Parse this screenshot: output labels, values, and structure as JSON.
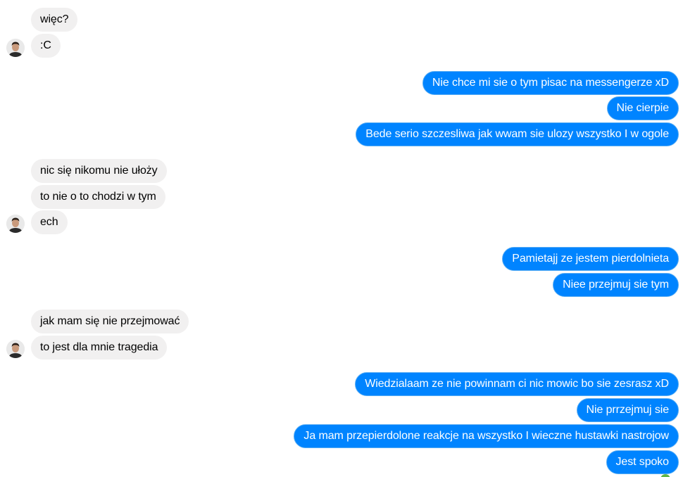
{
  "groups": [
    {
      "sender": "them",
      "messages": [
        "więc?",
        ":C"
      ]
    },
    {
      "sender": "me",
      "messages": [
        "Nie chce mi sie o tym pisac na messengerze xD",
        "Nie cierpie",
        "Bede serio szczesliwa jak wwam sie ulozy wszystko I w ogole"
      ]
    },
    {
      "sender": "them",
      "messages": [
        "nic się nikomu nie ułoży",
        "to nie o to chodzi w tym",
        "ech"
      ]
    },
    {
      "sender": "me",
      "messages": [
        "Pamietajj ze jestem pierdolnieta",
        "Niee przejmuj sie tym"
      ]
    },
    {
      "sender": "them",
      "messages": [
        "jak mam się nie przejmować",
        "to jest dla mnie tragedia"
      ]
    },
    {
      "sender": "me",
      "messages": [
        "Wiedzialaam ze nie powinnam ci nic mowic bo sie zesrasz xD",
        "Nie prrzejmuj sie",
        "Ja mam przepierdolone reakcje na wszystko I wieczne hustawki nastrojow",
        "Jest spoko"
      ]
    }
  ],
  "colors": {
    "incoming_bubble": "#f1f0f0",
    "outgoing_bubble": "#0084ff",
    "seen_indicator": "#5fb548"
  },
  "icons": {
    "contact_avatar": "avatar",
    "read_receipt": "seen-avatar-icon"
  }
}
